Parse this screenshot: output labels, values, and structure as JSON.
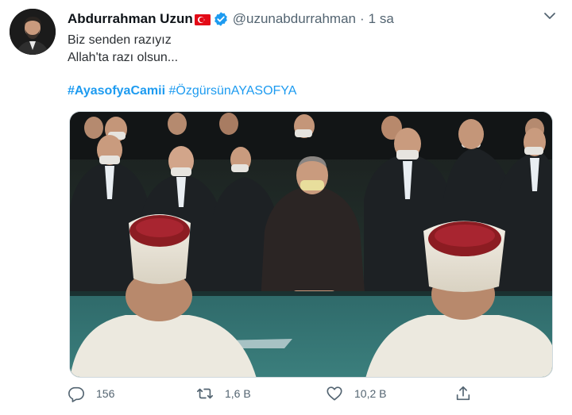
{
  "tweet": {
    "display_name": "Abdurrahman Uzun",
    "handle": "@uzunabdurrahman",
    "separator": "·",
    "time": "1 sa",
    "text_line1": "Biz senden razıyız",
    "text_line2": "Allah'ta razı olsun...",
    "hashtag1": "#AyasofyaCamii",
    "hashtag2": "#ÖzgürsünAYASOFYA"
  },
  "icons": {
    "flag": "turkey-flag-icon",
    "verified": "verified-badge-icon",
    "caret": "chevron-down-icon",
    "reply": "reply-icon",
    "retweet": "retweet-icon",
    "like": "heart-icon",
    "share": "share-icon"
  },
  "actions": {
    "reply_count": "156",
    "retweet_count": "1,6 B",
    "like_count": "10,2 B"
  },
  "colors": {
    "link": "#1d9bf0",
    "muted": "#536471",
    "flag_red": "#e30a17",
    "verified_blue": "#1d9bf0"
  }
}
